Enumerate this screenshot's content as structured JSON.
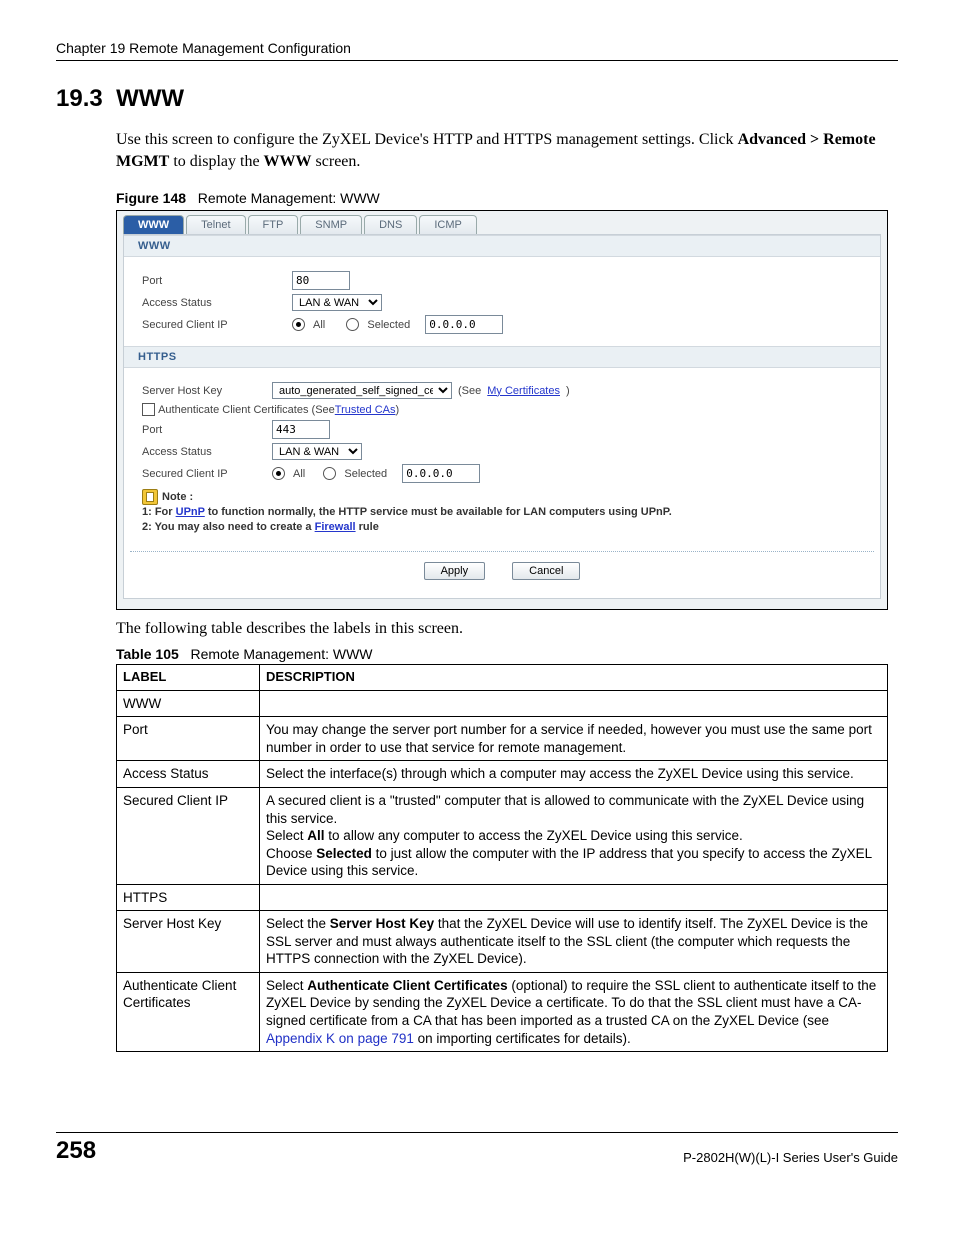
{
  "header": {
    "chapter": "Chapter 19 Remote Management Configuration"
  },
  "section": {
    "number": "19.3",
    "title": "WWW",
    "intro_1": "Use this screen to configure the ZyXEL Device's HTTP and HTTPS management settings. Click ",
    "intro_nav": "Advanced > Remote MGMT",
    "intro_2": " to display the ",
    "intro_screen": "WWW",
    "intro_3": " screen."
  },
  "figure": {
    "num": "Figure 148",
    "title": "Remote Management: WWW",
    "tabs": [
      "WWW",
      "Telnet",
      "FTP",
      "SNMP",
      "DNS",
      "ICMP"
    ],
    "www": {
      "head": "WWW",
      "port_lbl": "Port",
      "port_val": "80",
      "access_lbl": "Access Status",
      "access_val": "LAN & WAN",
      "secip_lbl": "Secured Client IP",
      "radio_all": "All",
      "radio_sel": "Selected",
      "secip_val": "0.0.0.0"
    },
    "https": {
      "head": "HTTPS",
      "shk_lbl": "Server Host Key",
      "shk_val": "auto_generated_self_signed_cert",
      "see_open": "(See ",
      "mycerts": "My Certificates",
      "see_close": ")",
      "auth_lbl": "Authenticate Client Certificates (See ",
      "trusted_cas": "Trusted CAs",
      "auth_close": ")",
      "port_lbl": "Port",
      "port_val": "443",
      "access_lbl": "Access Status",
      "access_val": "LAN & WAN",
      "secip_lbl": "Secured Client IP",
      "radio_all": "All",
      "radio_sel": "Selected",
      "secip_val": "0.0.0.0",
      "note_title": "Note :",
      "note_1a": "1: For ",
      "note_upnp": "UPnP",
      "note_1b": " to function normally, the HTTP service must be available for LAN computers using UPnP.",
      "note_2a": "2: You may also need to create a ",
      "note_firewall": "Firewall",
      "note_2b": " rule"
    },
    "buttons": {
      "apply": "Apply",
      "cancel": "Cancel"
    }
  },
  "after_fig": "The following table describes the labels in this screen.",
  "table": {
    "num": "Table 105",
    "title": "Remote Management: WWW",
    "head_label": "LABEL",
    "head_desc": "DESCRIPTION",
    "rows": [
      {
        "label": "WWW",
        "desc": ""
      },
      {
        "label": "Port",
        "desc": "You may change the server port number for a service if needed, however you must use the same port number in order to use that service for remote management."
      },
      {
        "label": "Access Status",
        "desc": "Select the interface(s) through which a computer may access the ZyXEL Device using this service."
      },
      {
        "label": "Secured Client IP",
        "desc": ""
      },
      {
        "label": "HTTPS",
        "desc": ""
      },
      {
        "label": "Server Host Key",
        "desc": ""
      },
      {
        "label": "Authenticate Client Certificates",
        "desc": ""
      }
    ],
    "secured_p1": "A secured client is a \"trusted\" computer that is allowed to communicate with the ZyXEL Device using this service.",
    "secured_p2a": "Select ",
    "secured_all": "All",
    "secured_p2b": " to allow any computer to access the ZyXEL Device using this service.",
    "secured_p3a": "Choose ",
    "secured_sel": "Selected",
    "secured_p3b": " to just allow the computer with the IP address that you specify to access the ZyXEL Device using this service.",
    "shk_a": "Select the ",
    "shk_b": "Server Host Key",
    "shk_c": " that the ZyXEL Device will use to identify itself. The ZyXEL Device is the SSL server and must always authenticate itself to the SSL client (the computer which requests the HTTPS connection with the ZyXEL Device).",
    "auth_a": "Select ",
    "auth_b": "Authenticate Client Certificates",
    "auth_c": " (optional) to require the SSL client to authenticate itself to the ZyXEL Device by sending the ZyXEL Device a certificate. To do that the SSL client must have a CA-signed certificate from a CA that has been imported as a trusted CA on the ZyXEL Device (see ",
    "auth_link": "Appendix K on page 791",
    "auth_d": " on importing certificates for details)."
  },
  "footer": {
    "page": "258",
    "guide": "P-2802H(W)(L)-I Series User's Guide"
  }
}
